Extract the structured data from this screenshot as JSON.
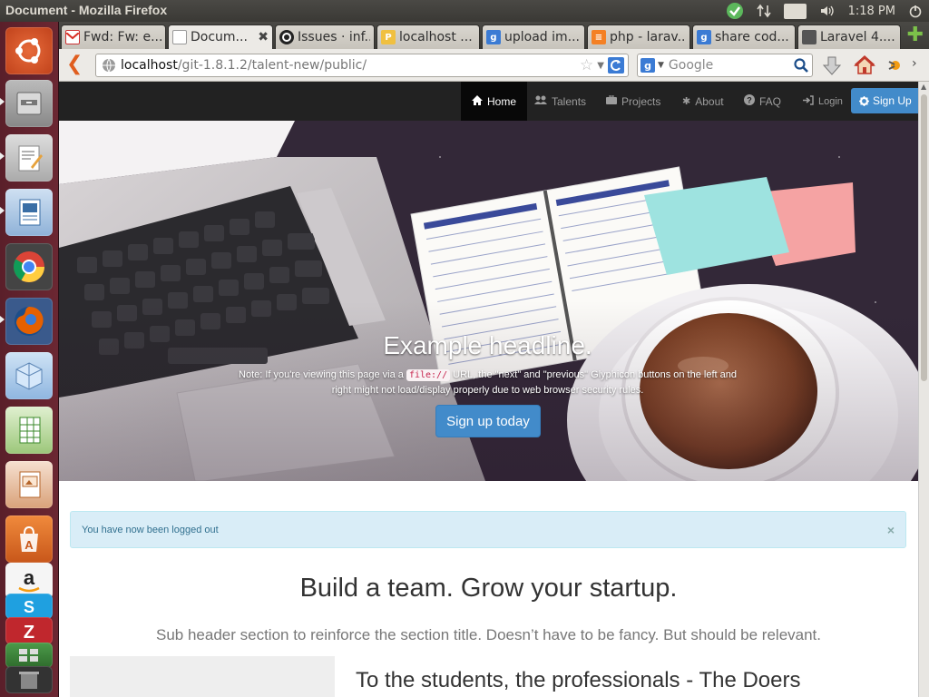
{
  "window": {
    "title": "Document - Mozilla Firefox"
  },
  "tray": {
    "lang": "En",
    "time": "1:18 PM"
  },
  "launcher": {
    "items": [
      "ubuntu-dash",
      "files",
      "text-editor",
      "libreoffice-impress",
      "chrome",
      "firefox",
      "virtualbox",
      "libreoffice-calc",
      "libreoffice-draw",
      "software-center",
      "amazon",
      "skype",
      "filezilla",
      "workspace"
    ]
  },
  "tabs": [
    {
      "label": "Fwd: Fw: e...",
      "icon": "gmail-icon"
    },
    {
      "label": "Docum...",
      "icon": "blank-page-icon",
      "active": true
    },
    {
      "label": "Issues · inf...",
      "icon": "github-icon"
    },
    {
      "label": "localhost ...",
      "icon": "pma-icon"
    },
    {
      "label": "upload im...",
      "icon": "google-icon"
    },
    {
      "label": "php - larav...",
      "icon": "stackoverflow-icon"
    },
    {
      "label": "share cod...",
      "icon": "google-icon"
    },
    {
      "label": "Laravel 4....",
      "icon": "laravel-icon"
    }
  ],
  "urlbar": {
    "host": "localhost",
    "path": "/git-1.8.1.2/talent-new/public/"
  },
  "search": {
    "placeholder": "Google"
  },
  "sitenav": {
    "items": [
      {
        "label": "Home",
        "icon": "home-icon",
        "active": true
      },
      {
        "label": "Talents",
        "icon": "users-icon"
      },
      {
        "label": "Projects",
        "icon": "briefcase-icon"
      },
      {
        "label": "About",
        "icon": "asterisk-icon"
      },
      {
        "label": "FAQ",
        "icon": "question-icon"
      },
      {
        "label": "Login",
        "icon": "login-icon"
      }
    ],
    "signup": "Sign Up"
  },
  "hero": {
    "headline": "Example headline.",
    "note_before": "Note: If you're viewing this page via a",
    "note_code": "file://",
    "note_after": "URL, the \"next\" and \"previous\" Glyphicon buttons on the left and right might not load/display properly due to web browser security rules.",
    "button": "Sign up today"
  },
  "alert": {
    "message": "You have now been logged out",
    "close": "×"
  },
  "section": {
    "title": "Build a team. Grow your startup.",
    "subtitle": "Sub header section to reinforce the section title. Doesn’t have to be fancy. But should be relevant.",
    "doers_heading": "To the students, the professionals - The Doers"
  }
}
